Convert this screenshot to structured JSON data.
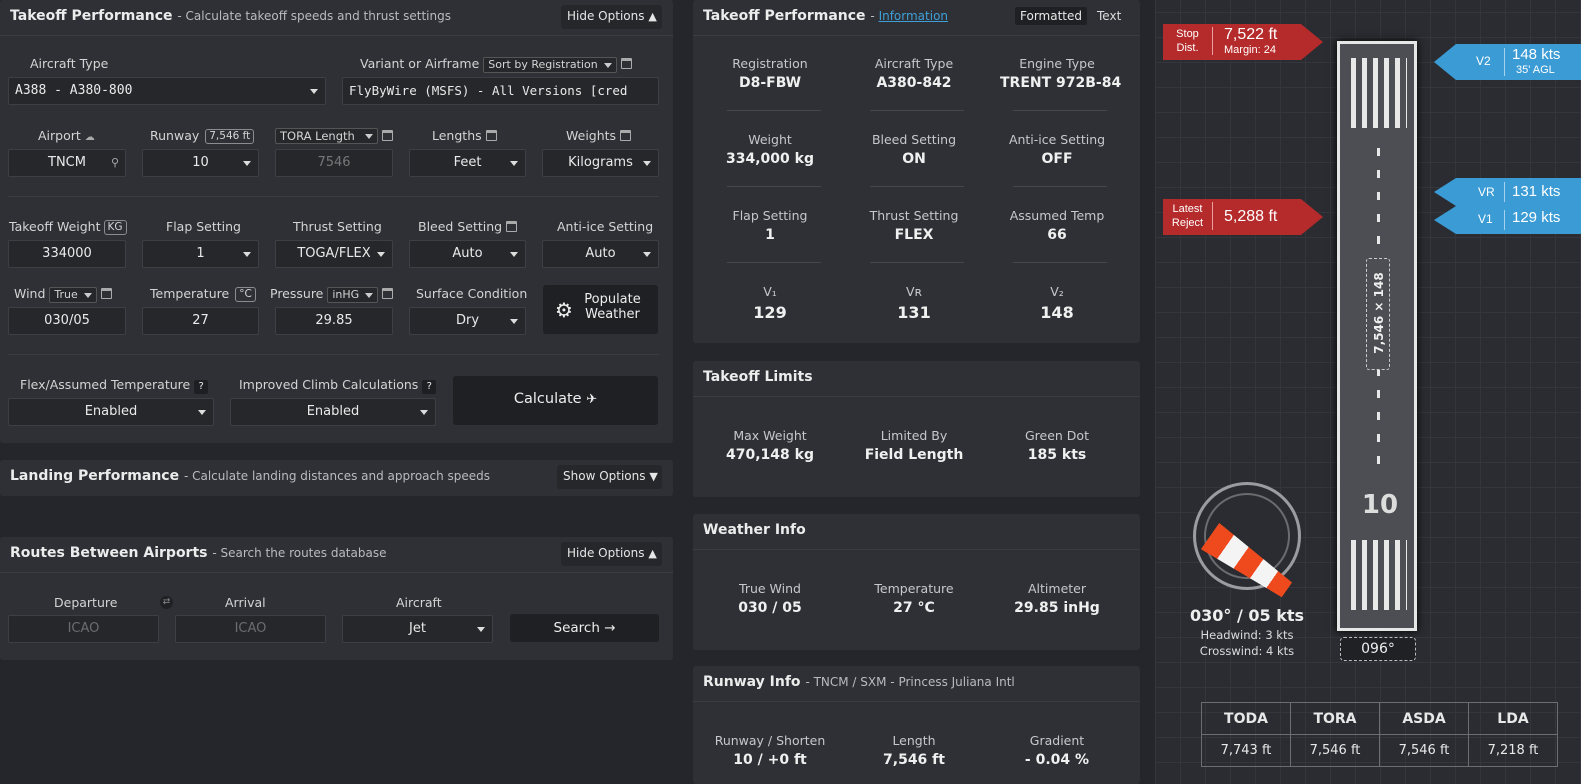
{
  "takeoff_form": {
    "title": "Takeoff Performance",
    "subtitle": "- Calculate takeoff speeds and thrust settings",
    "hide_options": "Hide Options",
    "aircraft_type_label": "Aircraft Type",
    "aircraft_type": "A388 - A380-800",
    "variant_label": "Variant or Airframe",
    "sort_label": "Sort by Registration",
    "variant": "FlyByWire (MSFS) - All Versions [cred",
    "airport_label": "Airport",
    "airport": "TNCM",
    "runway_label": "Runway",
    "runway_tag": "7,546 ft",
    "runway": "10",
    "tora_select": "TORA Length",
    "tora_value": "7546",
    "lengths_label": "Lengths",
    "lengths": "Feet",
    "weights_label": "Weights",
    "weights": "Kilograms",
    "takeoff_weight_label": "Takeoff Weight",
    "takeoff_weight_tag": "KG",
    "takeoff_weight": "334000",
    "flap_label": "Flap Setting",
    "flap": "1",
    "thrust_label": "Thrust Setting",
    "thrust": "TOGA/FLEX",
    "bleed_label": "Bleed Setting",
    "bleed": "Auto",
    "antiice_label": "Anti-ice Setting",
    "antiice": "Auto",
    "wind_label": "Wind",
    "wind_mode": "True",
    "wind": "030/05",
    "temp_label": "Temperature",
    "temp_tag": "°C",
    "temp": "27",
    "pressure_label": "Pressure",
    "pressure_unit": "inHG",
    "pressure": "29.85",
    "surface_label": "Surface Condition",
    "surface": "Dry",
    "populate_line1": "Populate",
    "populate_line2": "Weather",
    "flex_label": "Flex/Assumed Temperature",
    "flex": "Enabled",
    "improved_label": "Improved Climb Calculations",
    "improved": "Enabled",
    "question": "?",
    "calculate": "Calculate"
  },
  "landing": {
    "title": "Landing Performance",
    "subtitle": "- Calculate landing distances and approach speeds",
    "show_options": "Show Options"
  },
  "routes": {
    "title": "Routes Between Airports",
    "subtitle": "- Search the routes database",
    "hide_options": "Hide Options",
    "departure_label": "Departure",
    "departure_placeholder": "ICAO",
    "arrival_label": "Arrival",
    "arrival_placeholder": "ICAO",
    "aircraft_label": "Aircraft",
    "aircraft": "Jet",
    "search": "Search"
  },
  "results": {
    "title": "Takeoff Performance",
    "info_link": "Information",
    "tab_formatted": "Formatted",
    "tab_text": "Text",
    "registration_label": "Registration",
    "registration": "D8-FBW",
    "aircraft_label": "Aircraft Type",
    "aircraft": "A380-842",
    "engine_label": "Engine Type",
    "engine": "TRENT 972B-84",
    "weight_label": "Weight",
    "weight": "334,000 kg",
    "bleed_label": "Bleed Setting",
    "bleed": "ON",
    "antiice_label": "Anti-ice Setting",
    "antiice": "OFF",
    "flap_label": "Flap Setting",
    "flap": "1",
    "thrust_label": "Thrust Setting",
    "thrust": "FLEX",
    "assumed_label": "Assumed Temp",
    "assumed": "66",
    "v1_label": "V₁",
    "v1": "129",
    "vr_label": "Vʀ",
    "vr": "131",
    "v2_label": "V₂",
    "v2": "148"
  },
  "limits": {
    "title": "Takeoff Limits",
    "maxw_label": "Max Weight",
    "maxw": "470,148 kg",
    "limited_label": "Limited By",
    "limited": "Field Length",
    "greendot_label": "Green Dot",
    "greendot": "185 kts"
  },
  "weather": {
    "title": "Weather Info",
    "wind_label": "True Wind",
    "wind": "030 / 05",
    "temp_label": "Temperature",
    "temp": "27 °C",
    "alt_label": "Altimeter",
    "alt": "29.85 inHg"
  },
  "runway_info": {
    "title": "Runway Info",
    "subtitle": "- TNCM / SXM - Princess Juliana Intl",
    "shorten_label": "Runway / Shorten",
    "shorten": "10 / +0 ft",
    "length_label": "Length",
    "length": "7,546 ft",
    "gradient_label": "Gradient",
    "gradient": "- 0.04 %"
  },
  "diagram": {
    "stop_l1": "Stop",
    "stop_l2": "Dist.",
    "stop_value": "7,522 ft",
    "stop_margin": "Margin: 24",
    "reject_l1": "Latest",
    "reject_l2": "Reject",
    "reject_value": "5,288 ft",
    "v2_tag": "V2",
    "v2_value": "148 kts",
    "v2_sub": "35' AGL",
    "vr_tag": "VR",
    "vr_value": "131 kts",
    "v1_tag": "V1",
    "v1_value": "129 kts",
    "runway_dims": "7,546 × 148",
    "runway_number": "10",
    "heading": "096°",
    "wind_text": "030° / 05 kts",
    "headwind": "Headwind: 3 kts",
    "crosswind": "Crosswind: 4 kts",
    "table_headers": [
      "TODA",
      "TORA",
      "ASDA",
      "LDA"
    ],
    "table_values": [
      "7,743 ft",
      "7,546 ft",
      "7,546 ft",
      "7,218 ft"
    ]
  },
  "colors": {
    "red": "#b52a2a",
    "blue": "#3a9bd5",
    "panel": "#2e3035"
  }
}
